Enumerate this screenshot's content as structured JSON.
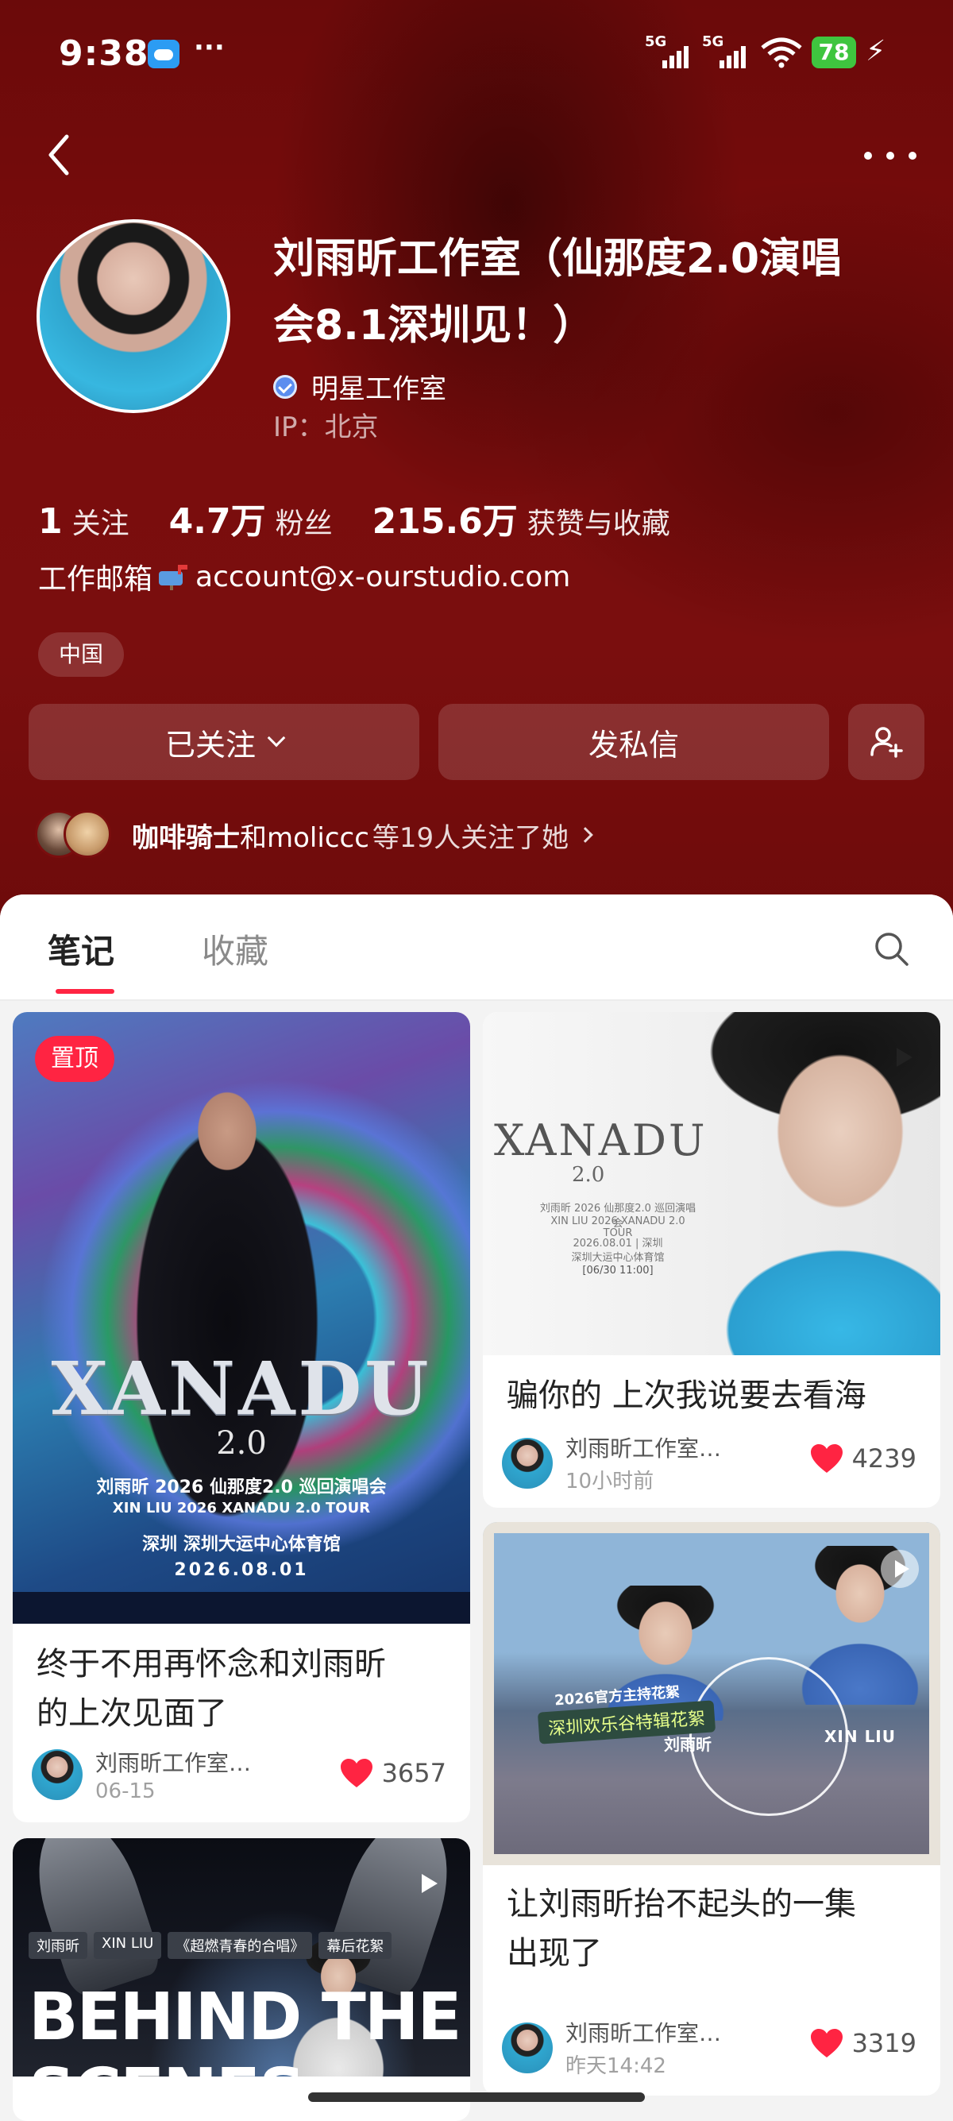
{
  "status_bar": {
    "time": "9:38",
    "signal_1": "5G",
    "signal_2": "5G",
    "battery": "78",
    "overflow": "···"
  },
  "profile": {
    "name": "刘雨昕工作室（仙那度2.0演唱会8.1深圳见！）",
    "verified_label": "明星工作室",
    "ip": "IP：北京",
    "stats": [
      {
        "num": "1",
        "label": "关注"
      },
      {
        "num": "4.7万",
        "label": "粉丝"
      },
      {
        "num": "215.6万",
        "label": "获赞与收藏"
      }
    ],
    "email_prefix": "工作邮箱",
    "email": "account@x-ourstudio.com",
    "region_tag": "中国",
    "follow_btn": "已关注",
    "message_btn": "发私信",
    "mutual_name": "咖啡骑士",
    "mutual_and": "和moliccc",
    "mutual_rest": "等19人关注了她"
  },
  "tabs": {
    "notes": "笔记",
    "collect": "收藏"
  },
  "cards": [
    {
      "pinned": "置顶",
      "title_line1": "终于不用再怀念和刘雨昕",
      "title_line2": "的上次见面了",
      "author": "刘雨昕工作室…",
      "time": "06-15",
      "likes": "3657",
      "poster": {
        "logo": "XANADU",
        "sub": "2.0",
        "line1": "刘雨昕 2026 仙那度2.0 巡回演唱会",
        "line2": "XIN LIU  2026  XANADU 2.0  TOUR",
        "line3": "深圳  深圳大运中心体育馆",
        "line4": "2026.08.01"
      }
    },
    {
      "title_line1": "骗你的 上次我说要去看海",
      "author": "刘雨昕工作室…",
      "time": "10小时前",
      "likes": "4239",
      "poster": {
        "logo": "XANADU",
        "sub": "2.0",
        "line1": "刘雨昕 2026 仙那度2.0 巡回演唱会",
        "line2": "XIN LIU 2026 XANADU 2.0 TOUR",
        "line3": "2026.08.01 | 深圳",
        "line4": "深圳大运中心体育馆",
        "line5": "[06/30 11:00]"
      }
    },
    {
      "title_line1": "让刘雨昕抬不起头的一集",
      "title_line2": "出现了",
      "author": "刘雨昕工作室…",
      "time": "昨天14:42",
      "likes": "3319",
      "image_caption1": "2026官方主持花絮",
      "image_caption2": "深圳欢乐谷特辑花絮",
      "image_caption3": "刘雨昕",
      "image_caption4": "XIN LIU"
    },
    {
      "image_tags": [
        "刘雨昕",
        "XIN LIU",
        "《超燃青春的合唱》",
        "幕后花絮"
      ],
      "image_title": "BEHIND THE SCENES"
    }
  ]
}
